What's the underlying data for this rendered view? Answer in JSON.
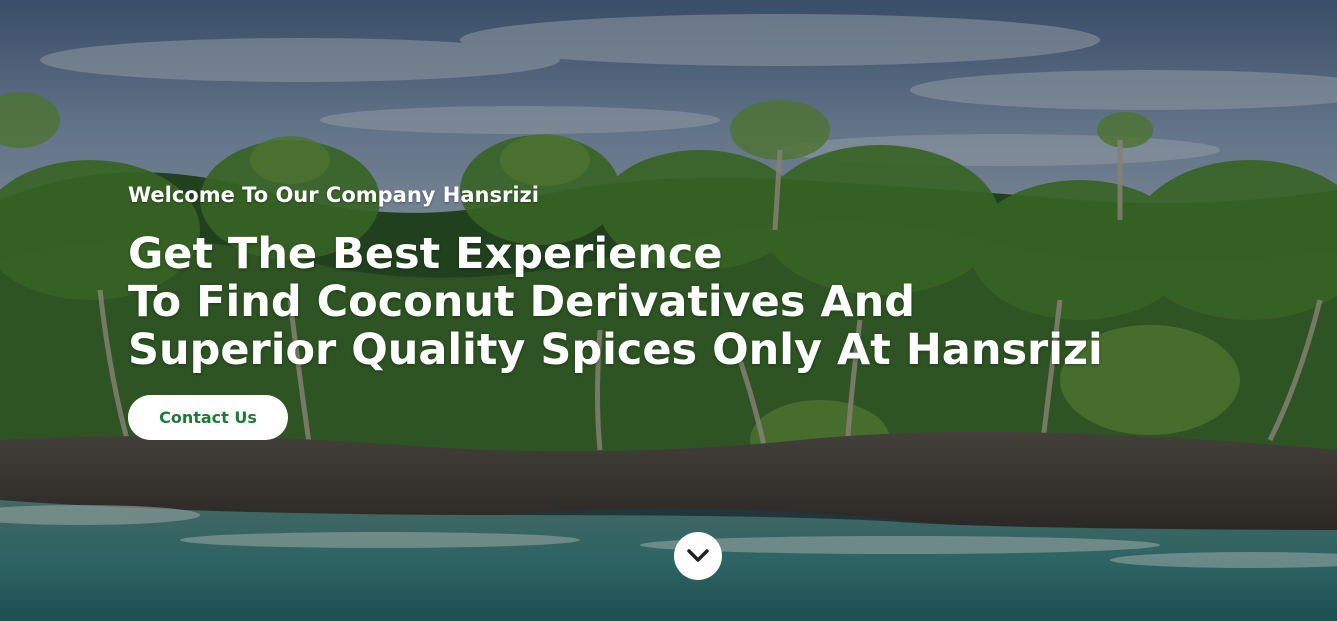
{
  "hero": {
    "eyebrow": "Welcome To Our Company Hansrizi",
    "headline_lines": [
      "Get The Best Experience",
      "To Find Coconut Derivatives And",
      "Superior Quality Spices Only At Hansrizi"
    ],
    "cta_label": "Contact Us",
    "scroll_icon": "chevron-down-icon"
  },
  "colors": {
    "accent": "#1f7a3a",
    "text": "#ffffff",
    "button_bg": "#ffffff"
  }
}
